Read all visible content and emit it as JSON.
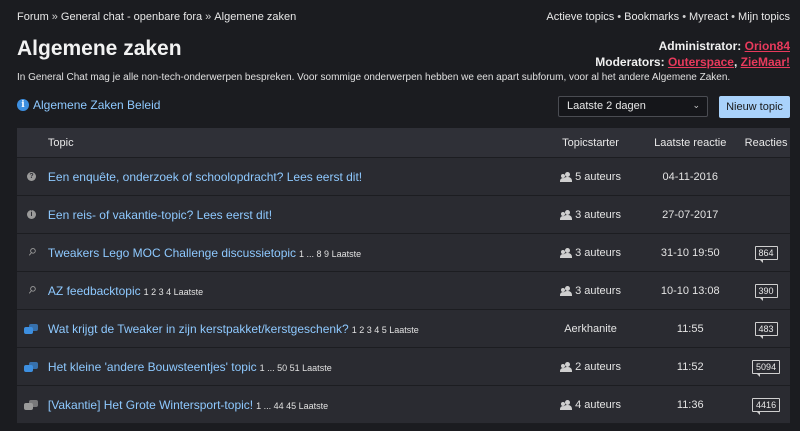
{
  "breadcrumb": [
    "Forum",
    "General chat - openbare fora",
    "Algemene zaken"
  ],
  "breadcrumb_sep": "»",
  "userlinks": [
    "Actieve topics",
    "Bookmarks",
    "Myreact",
    "Mijn topics"
  ],
  "userlinks_sep": "•",
  "page_title": "Algemene zaken",
  "staff": {
    "admin_label": "Administrator:",
    "admin_name": "Orion84",
    "mod_label": "Moderators:",
    "mods": [
      "Outerspace",
      "ZieMaar!"
    ],
    "mods_sep": ", "
  },
  "description": "In General Chat mag je alle non-tech-onderwerpen bespreken. Voor sommige onderwerpen hebben we een apart subforum, voor al het andere Algemene Zaken.",
  "policy_link": "Algemene Zaken Beleid",
  "policy_icon": "i",
  "filter_select": "Laatste 2 dagen",
  "new_topic_button": "Nieuw topic",
  "colors": {
    "accent_link": "#8ec9ff",
    "staff_red": "#e83a5c",
    "button_bg": "#a9d2fb",
    "bubble_blue": "#3d8fe0"
  },
  "table": {
    "headers": {
      "topic": "Topic",
      "starter": "Topicstarter",
      "last": "Laatste reactie",
      "replies": "Reacties"
    },
    "rows": [
      {
        "icon": "question-icon",
        "title": "Een enquête, onderzoek of schoolopdracht? Lees eerst dit!",
        "pages": "",
        "starter": "5 auteurs",
        "starter_icon": true,
        "last": "04-11-2016",
        "replies": ""
      },
      {
        "icon": "info-icon",
        "title": "Een reis- of vakantie-topic? Lees eerst dit!",
        "pages": "",
        "starter": "3 auteurs",
        "starter_icon": true,
        "last": "27-07-2017",
        "replies": ""
      },
      {
        "icon": "pin-icon",
        "title": "Tweakers Lego MOC Challenge discussietopic",
        "pages": "1 ... 8 9 Laatste",
        "starter": "3 auteurs",
        "starter_icon": true,
        "last": "31-10 19:50",
        "replies": "864"
      },
      {
        "icon": "pin-icon",
        "title": "AZ feedbacktopic",
        "pages": "1 2 3 4 Laatste",
        "starter": "3 auteurs",
        "starter_icon": true,
        "last": "10-10 13:08",
        "replies": "390"
      },
      {
        "icon": "hot-bubble-icon",
        "title": "Wat krijgt de Tweaker in zijn kerstpakket/kerstgeschenk?",
        "pages": "1 2 3 4 5 Laatste",
        "starter": "Aerkhanite",
        "starter_icon": false,
        "last": "11:55",
        "replies": "483"
      },
      {
        "icon": "hot-bubble-icon",
        "title": "Het kleine 'andere Bouwsteentjes' topic",
        "pages": "1 ... 50 51 Laatste",
        "starter": "2 auteurs",
        "starter_icon": true,
        "last": "11:52",
        "replies": "5094"
      },
      {
        "icon": "bubble-icon",
        "title": "[Vakantie] Het Grote Wintersport-topic!",
        "pages": "1 ... 44 45 Laatste",
        "starter": "4 auteurs",
        "starter_icon": true,
        "last": "11:36",
        "replies": "4416"
      }
    ]
  }
}
